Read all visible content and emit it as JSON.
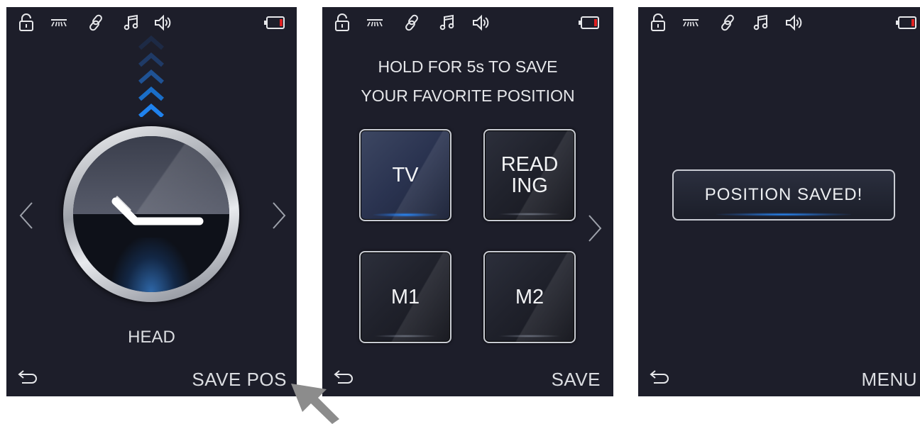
{
  "status_icons": [
    "lock-icon",
    "light-icon",
    "link-icon",
    "music-icon",
    "volume-icon",
    "battery-icon"
  ],
  "colors": {
    "screen_bg": "#1d1e2a",
    "accent_blue": "#1f7fe6",
    "battery_low": "#e02020",
    "text": "#e4e6ea"
  },
  "screen1": {
    "mode_label": "HEAD",
    "action_label": "SAVE POS"
  },
  "screen2": {
    "instruction_line1": "HOLD FOR 5s TO SAVE",
    "instruction_line2": "YOUR FAVORITE POSITION",
    "presets": [
      {
        "label_line1": "TV",
        "label_line2": "",
        "active": true
      },
      {
        "label_line1": "READ",
        "label_line2": "ING",
        "active": false
      },
      {
        "label_line1": "M1",
        "label_line2": "",
        "active": false
      },
      {
        "label_line1": "M2",
        "label_line2": "",
        "active": false
      }
    ],
    "action_label": "SAVE"
  },
  "screen3": {
    "message": "POSITION SAVED!",
    "action_label": "MENU"
  }
}
